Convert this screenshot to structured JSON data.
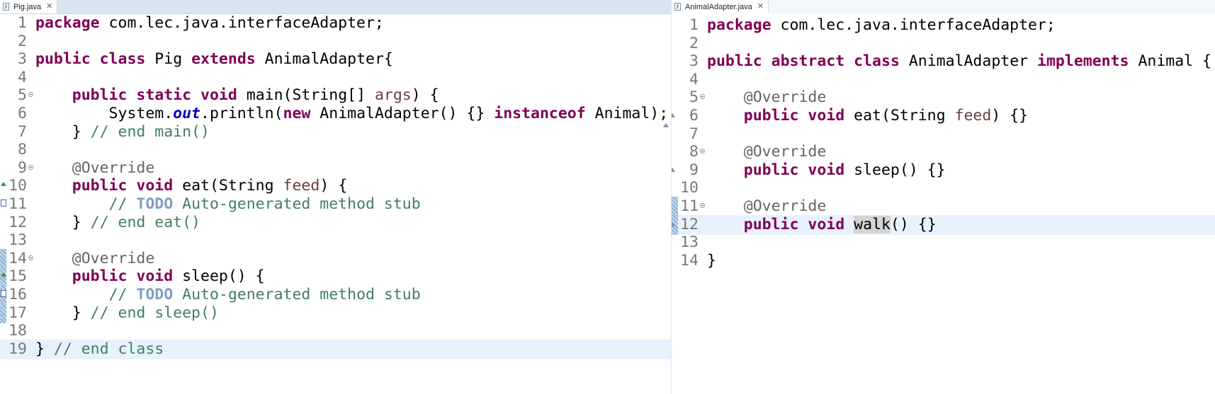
{
  "left_editor": {
    "tab_label": "Pig.java",
    "tab_icon": "java-file-icon",
    "lines": [
      {
        "n": "1",
        "parts": [
          {
            "t": "kw",
            "v": "package"
          },
          {
            "t": "",
            "v": " com.lec.java.interfaceAdapter;"
          }
        ]
      },
      {
        "n": "2",
        "parts": []
      },
      {
        "n": "3",
        "parts": [
          {
            "t": "kw",
            "v": "public"
          },
          {
            "t": "",
            "v": " "
          },
          {
            "t": "kw",
            "v": "class"
          },
          {
            "t": "",
            "v": " Pig "
          },
          {
            "t": "kw",
            "v": "extends"
          },
          {
            "t": "",
            "v": " AnimalAdapter{"
          }
        ]
      },
      {
        "n": "4",
        "parts": []
      },
      {
        "n": "5",
        "fold": true,
        "parts": [
          {
            "t": "",
            "v": "    "
          },
          {
            "t": "kw",
            "v": "public"
          },
          {
            "t": "",
            "v": " "
          },
          {
            "t": "kw",
            "v": "static"
          },
          {
            "t": "",
            "v": " "
          },
          {
            "t": "kw",
            "v": "void"
          },
          {
            "t": "",
            "v": " main(String[] "
          },
          {
            "t": "param",
            "v": "args"
          },
          {
            "t": "",
            "v": ") {"
          }
        ]
      },
      {
        "n": "6",
        "parts": [
          {
            "t": "",
            "v": "        System."
          },
          {
            "t": "stat",
            "v": "out"
          },
          {
            "t": "",
            "v": ".println("
          },
          {
            "t": "kw",
            "v": "new"
          },
          {
            "t": "",
            "v": " AnimalAdapter() {} "
          },
          {
            "t": "kw",
            "v": "instanceof"
          },
          {
            "t": "",
            "v": " Animal);"
          }
        ]
      },
      {
        "n": "7",
        "parts": [
          {
            "t": "",
            "v": "    } "
          },
          {
            "t": "cm",
            "v": "// end main()"
          }
        ]
      },
      {
        "n": "8",
        "parts": []
      },
      {
        "n": "9",
        "fold": true,
        "parts": [
          {
            "t": "",
            "v": "    "
          },
          {
            "t": "ann",
            "v": "@Override"
          }
        ]
      },
      {
        "n": "10",
        "ov": "override-up",
        "parts": [
          {
            "t": "",
            "v": "    "
          },
          {
            "t": "kw",
            "v": "public"
          },
          {
            "t": "",
            "v": " "
          },
          {
            "t": "kw",
            "v": "void"
          },
          {
            "t": "",
            "v": " eat(String "
          },
          {
            "t": "param",
            "v": "feed"
          },
          {
            "t": "",
            "v": ") {"
          }
        ]
      },
      {
        "n": "11",
        "ov": "task",
        "parts": [
          {
            "t": "",
            "v": "        "
          },
          {
            "t": "cm",
            "v": "// "
          },
          {
            "t": "todo",
            "v": "TODO"
          },
          {
            "t": "cm",
            "v": " Auto-generated method stub"
          }
        ]
      },
      {
        "n": "12",
        "parts": [
          {
            "t": "",
            "v": "    } "
          },
          {
            "t": "cm",
            "v": "// end eat()"
          }
        ]
      },
      {
        "n": "13",
        "parts": []
      },
      {
        "n": "14",
        "fold": true,
        "ov": "bar",
        "parts": [
          {
            "t": "",
            "v": "    "
          },
          {
            "t": "ann",
            "v": "@Override"
          }
        ]
      },
      {
        "n": "15",
        "ov": "bar-override",
        "parts": [
          {
            "t": "",
            "v": "    "
          },
          {
            "t": "kw",
            "v": "public"
          },
          {
            "t": "",
            "v": " "
          },
          {
            "t": "kw",
            "v": "void"
          },
          {
            "t": "",
            "v": " sleep() {"
          }
        ]
      },
      {
        "n": "16",
        "ov": "bar-task",
        "parts": [
          {
            "t": "",
            "v": "        "
          },
          {
            "t": "cm",
            "v": "// "
          },
          {
            "t": "todo",
            "v": "TODO"
          },
          {
            "t": "cm",
            "v": " Auto-generated method stub"
          }
        ]
      },
      {
        "n": "17",
        "ov": "bar",
        "parts": [
          {
            "t": "",
            "v": "    } "
          },
          {
            "t": "cm",
            "v": "// end sleep()"
          }
        ]
      },
      {
        "n": "18",
        "parts": []
      },
      {
        "n": "19",
        "current": true,
        "parts": [
          {
            "t": "",
            "v": "} "
          },
          {
            "t": "cm",
            "v": "// end class"
          }
        ]
      }
    ]
  },
  "right_editor": {
    "tab_label": "AnimalAdapter.java",
    "tab_icon": "java-file-icon",
    "lines": [
      {
        "n": "1",
        "parts": [
          {
            "t": "kw",
            "v": "package"
          },
          {
            "t": "",
            "v": " com.lec.java.interfaceAdapter;"
          }
        ]
      },
      {
        "n": "2",
        "parts": []
      },
      {
        "n": "3",
        "parts": [
          {
            "t": "kw",
            "v": "public"
          },
          {
            "t": "",
            "v": " "
          },
          {
            "t": "kw",
            "v": "abstract"
          },
          {
            "t": "",
            "v": " "
          },
          {
            "t": "kw",
            "v": "class"
          },
          {
            "t": "",
            "v": " AnimalAdapter "
          },
          {
            "t": "kw",
            "v": "implements"
          },
          {
            "t": "",
            "v": " Animal {"
          }
        ]
      },
      {
        "n": "4",
        "parts": []
      },
      {
        "n": "5",
        "fold": true,
        "parts": [
          {
            "t": "",
            "v": "    "
          },
          {
            "t": "ann",
            "v": "@Override"
          }
        ]
      },
      {
        "n": "6",
        "ov": "implements",
        "parts": [
          {
            "t": "",
            "v": "    "
          },
          {
            "t": "kw",
            "v": "public"
          },
          {
            "t": "",
            "v": " "
          },
          {
            "t": "kw",
            "v": "void"
          },
          {
            "t": "",
            "v": " eat(String "
          },
          {
            "t": "param",
            "v": "feed"
          },
          {
            "t": "",
            "v": ") {}"
          }
        ]
      },
      {
        "n": "7",
        "parts": []
      },
      {
        "n": "8",
        "fold": true,
        "parts": [
          {
            "t": "",
            "v": "    "
          },
          {
            "t": "ann",
            "v": "@Override"
          }
        ]
      },
      {
        "n": "9",
        "ov": "implements",
        "parts": [
          {
            "t": "",
            "v": "    "
          },
          {
            "t": "kw",
            "v": "public"
          },
          {
            "t": "",
            "v": " "
          },
          {
            "t": "kw",
            "v": "void"
          },
          {
            "t": "",
            "v": " sleep() {}"
          }
        ]
      },
      {
        "n": "10",
        "parts": []
      },
      {
        "n": "11",
        "fold": true,
        "ov": "bar",
        "parts": [
          {
            "t": "",
            "v": "    "
          },
          {
            "t": "ann",
            "v": "@Override"
          }
        ]
      },
      {
        "n": "12",
        "current": true,
        "ov": "bar-implements",
        "parts": [
          {
            "t": "",
            "v": "    "
          },
          {
            "t": "kw",
            "v": "public"
          },
          {
            "t": "",
            "v": " "
          },
          {
            "t": "kw",
            "v": "void"
          },
          {
            "t": "",
            "v": " "
          },
          {
            "t": "occ",
            "v": "walk"
          },
          {
            "t": "",
            "v": "() {}"
          }
        ]
      },
      {
        "n": "13",
        "parts": []
      },
      {
        "n": "14",
        "parts": [
          {
            "t": "",
            "v": "}"
          }
        ]
      }
    ]
  },
  "colors": {
    "keyword": "#7f0055",
    "comment": "#3f7f5f",
    "todo": "#7f9fbf",
    "annotation": "#646464",
    "parameter": "#6a3e3e",
    "static_field": "#0000c0",
    "current_line": "#e8f2fe",
    "line_number": "#787878"
  }
}
